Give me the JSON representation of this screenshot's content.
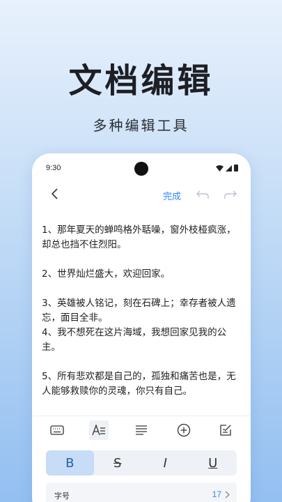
{
  "hero": {
    "title": "文档编辑",
    "subtitle": "多种编辑工具"
  },
  "status_bar": {
    "time": "9:30"
  },
  "editor_toolbar": {
    "done_label": "完成"
  },
  "document": {
    "paragraphs": [
      "1、那年夏天的蝉鸣格外聒噪，窗外枝桠疯涨，却总也挡不住烈阳。",
      "2、世界灿烂盛大，欢迎回家。",
      "3、英雄被人铭记，刻在石碑上；幸存者被人遗忘，面目全非。",
      "4、我不想死在这片海域，我想回家见我的公主。",
      "5、所有悲欢都是自己的，孤独和痛苦也是，无人能够救赎你的灵魂，你只有自己。"
    ]
  },
  "text_styles": {
    "bold": "B",
    "strikethrough": "S",
    "italic": "I",
    "underline": "U"
  },
  "font_size": {
    "label": "字号",
    "value": "17"
  },
  "colors": {
    "accent": "#2f86f6",
    "active_style_bg": "#c6dcf7"
  }
}
